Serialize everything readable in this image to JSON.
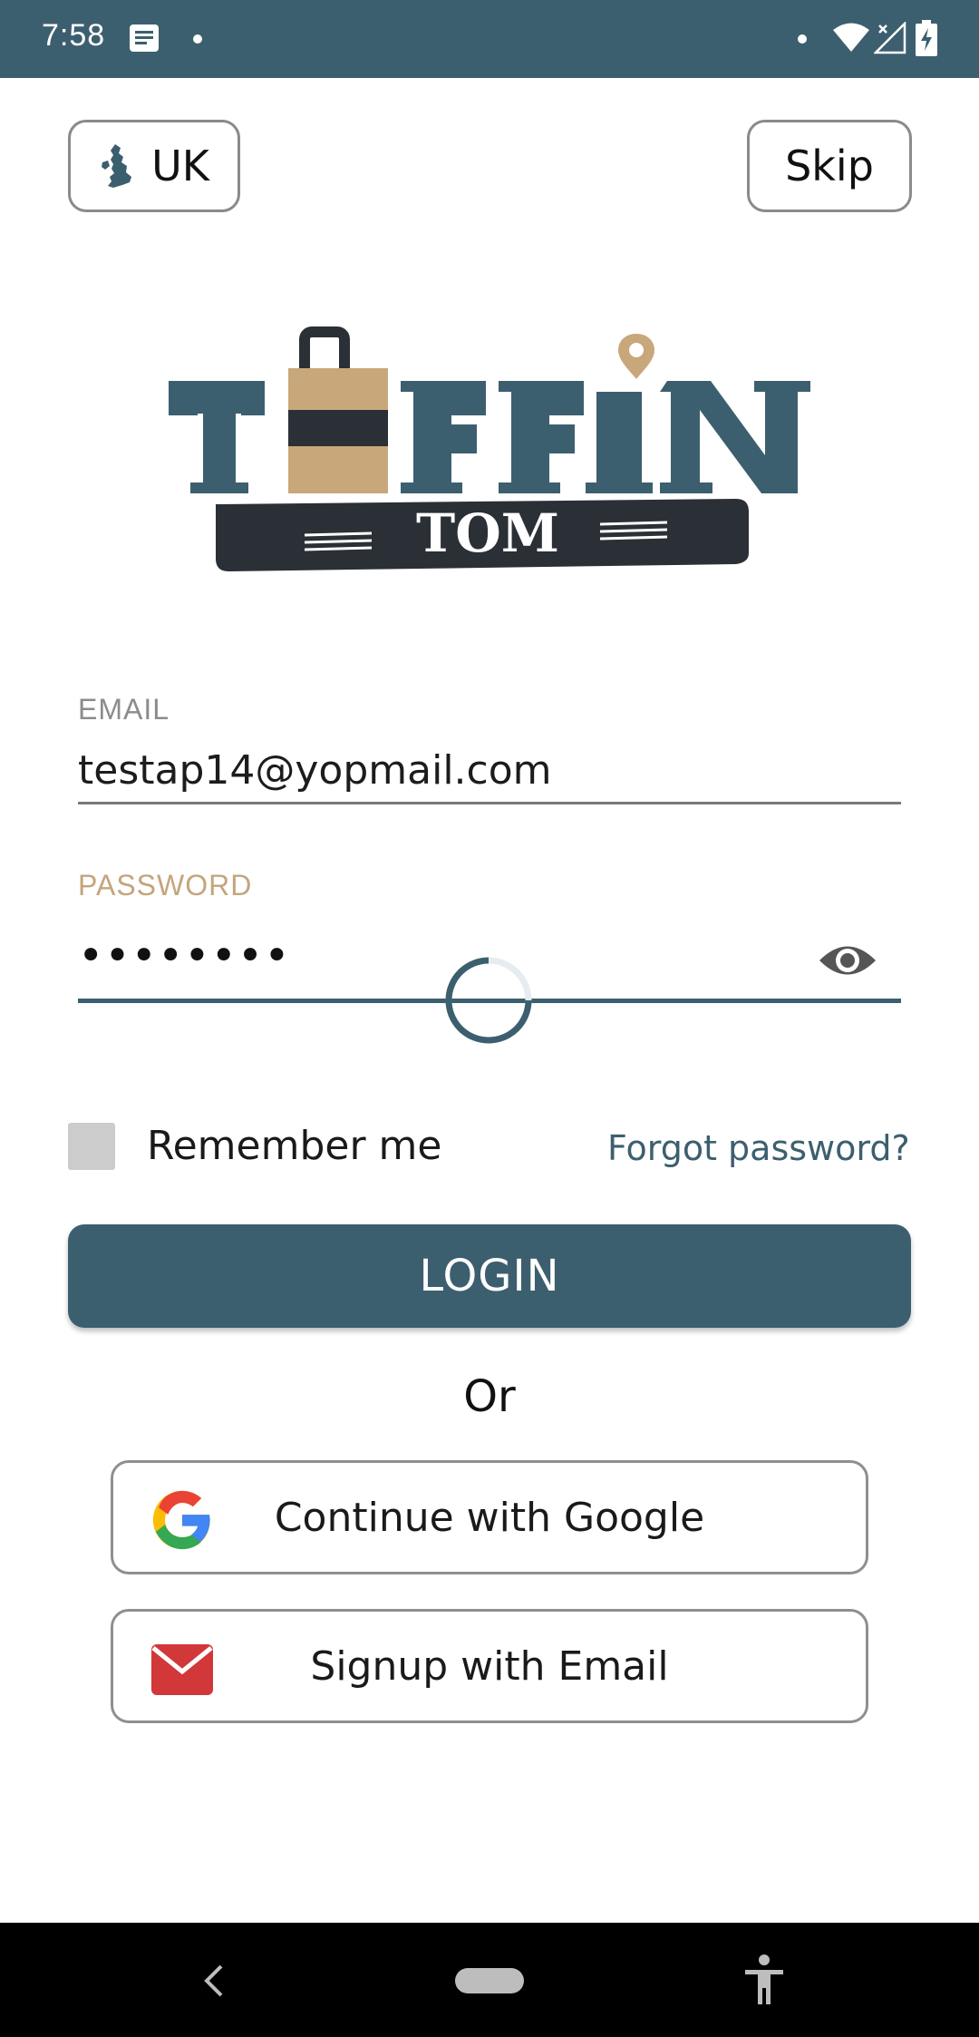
{
  "status_bar": {
    "time": "7:58",
    "icons": [
      "message-icon",
      "dot",
      "dot",
      "wifi-icon",
      "signal-icon",
      "battery-charging-icon"
    ],
    "background": "#3c5f6f"
  },
  "header": {
    "region_label": "UK",
    "region_icon": "uk-map-icon",
    "skip_label": "Skip"
  },
  "logo": {
    "word_main": "TIFFIN",
    "word_sub": "TOM",
    "colors": {
      "primary": "#3c5f6f",
      "gold": "#c8a77a",
      "dark": "#2b2f36"
    }
  },
  "form": {
    "email_label": "EMAIL",
    "email_value": "testap14@yopmail.com",
    "password_label": "PASSWORD",
    "password_value": "••••••••",
    "password_toggle_icon": "eye-icon",
    "remember_label": "Remember me",
    "remember_checked": false,
    "forgot_label": "Forgot password?",
    "login_label": "LOGIN",
    "loading": true
  },
  "alt_auth": {
    "or_label": "Or",
    "google_label": "Continue with Google",
    "google_icon": "google-icon",
    "email_label": "Signup with Email",
    "email_icon": "envelope-icon"
  },
  "theme": {
    "accent": "#3c5f6f",
    "label_gold": "#c4a57c",
    "envelope_red": "#d2373a"
  },
  "nav_bar": {
    "icons": [
      "back-icon",
      "home-pill",
      "accessibility-icon"
    ]
  }
}
